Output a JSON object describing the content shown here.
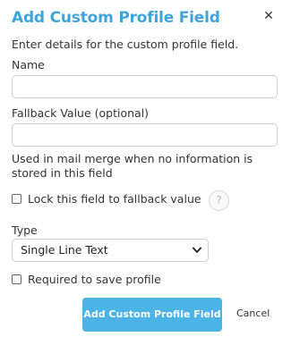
{
  "dialog": {
    "title": "Add Custom Profile Field",
    "close_icon": "✕",
    "intro": "Enter details for the custom profile field.",
    "name_label": "Name",
    "name_value": "",
    "fallback_label": "Fallback Value (optional)",
    "fallback_value": "",
    "fallback_help": "Used in mail merge when no information is stored in this field",
    "lock_label": "Lock this field to fallback value",
    "lock_checked": false,
    "help_icon": "?",
    "type_label": "Type",
    "type_selected": "Single Line Text",
    "required_label": "Required to save profile",
    "required_checked": false,
    "primary_button": "Add Custom Profile Field",
    "cancel_button": "Cancel"
  },
  "colors": {
    "title": "#3ea4dc",
    "primary_button": "#4cb3e6"
  },
  "icons": {
    "close": "close-icon",
    "help": "question-icon",
    "dropdown": "chevron-down-icon"
  }
}
